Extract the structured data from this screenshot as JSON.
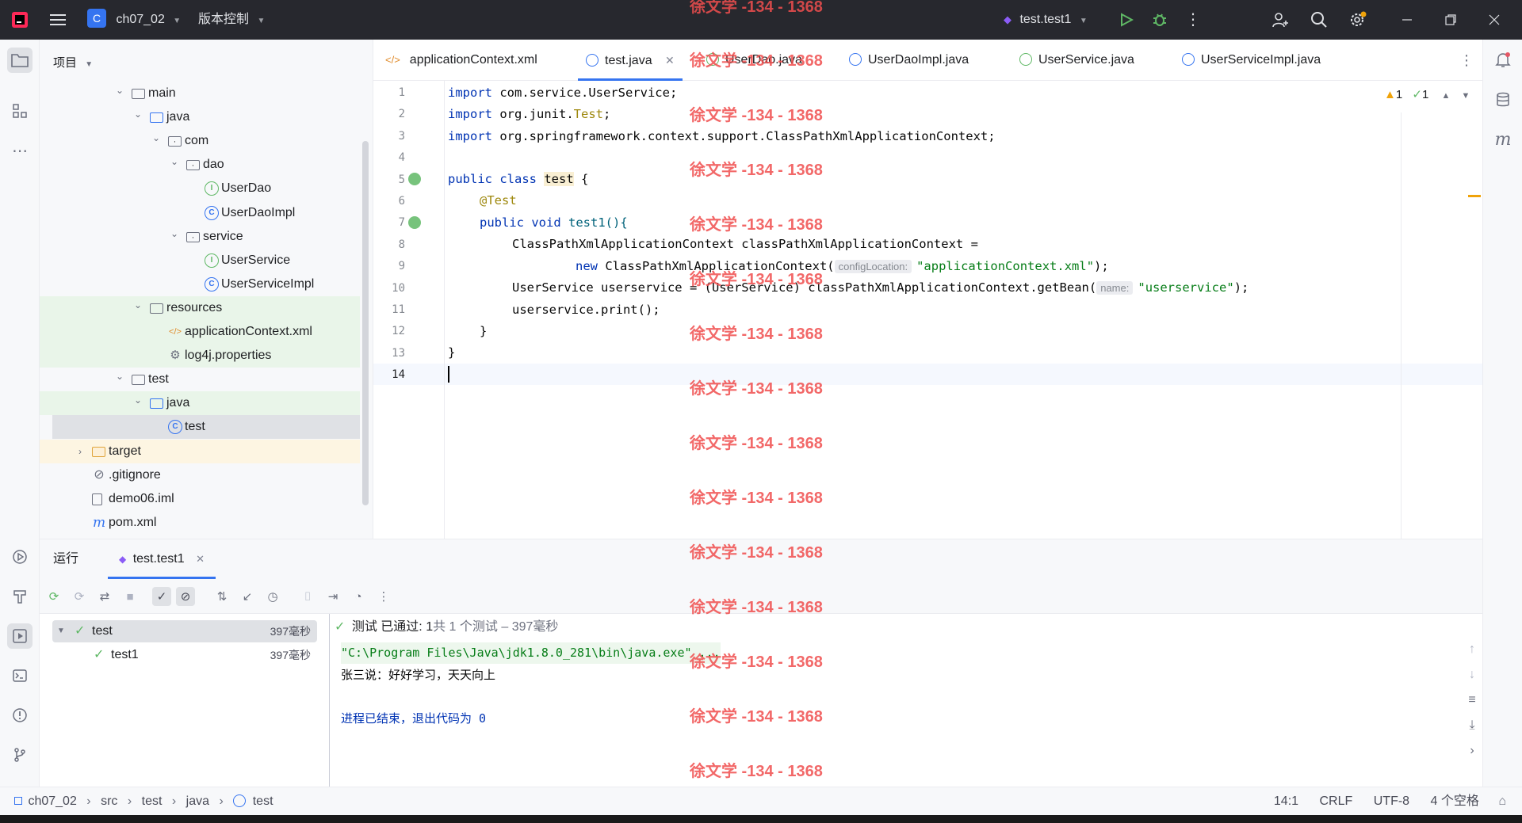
{
  "titlebar": {
    "app_icon": "intellij-icon",
    "menu_icon": "hamburger-icon",
    "project_badge": "C",
    "project_name": "ch07_02",
    "vcs_label": "版本控制",
    "run_config": "test.test1"
  },
  "project_panel": {
    "title": "项目",
    "tree": [
      {
        "label": "main",
        "kind": "folder",
        "indent": 0,
        "chevron": "down"
      },
      {
        "label": "java",
        "kind": "folder-blue",
        "indent": 1,
        "chevron": "down"
      },
      {
        "label": "com",
        "kind": "package",
        "indent": 2,
        "chevron": "down"
      },
      {
        "label": "dao",
        "kind": "package",
        "indent": 3,
        "chevron": "down"
      },
      {
        "label": "UserDao",
        "kind": "interface",
        "indent": 4,
        "chevron": ""
      },
      {
        "label": "UserDaoImpl",
        "kind": "class",
        "indent": 4,
        "chevron": ""
      },
      {
        "label": "service",
        "kind": "package",
        "indent": 3,
        "chevron": "down"
      },
      {
        "label": "UserService",
        "kind": "interface",
        "indent": 4,
        "chevron": ""
      },
      {
        "label": "UserServiceImpl",
        "kind": "class",
        "indent": 4,
        "chevron": ""
      },
      {
        "label": "resources",
        "kind": "folder",
        "indent": 1,
        "chevron": "down"
      },
      {
        "label": "applicationContext.xml",
        "kind": "xml",
        "indent": 2,
        "chevron": ""
      },
      {
        "label": "log4j.properties",
        "kind": "props",
        "indent": 2,
        "chevron": ""
      },
      {
        "label": "test",
        "kind": "folder",
        "indent": 0,
        "chevron": "down"
      },
      {
        "label": "java",
        "kind": "folder-blue",
        "indent": 1,
        "chevron": "down"
      },
      {
        "label": "test",
        "kind": "class",
        "indent": 2,
        "chevron": ""
      },
      {
        "label": "target",
        "kind": "folder-orange",
        "indent": -1,
        "chevron": "right"
      },
      {
        "label": ".gitignore",
        "kind": "ignore",
        "indent": -1,
        "chevron": ""
      },
      {
        "label": "demo06.iml",
        "kind": "iml",
        "indent": -1,
        "chevron": ""
      },
      {
        "label": "pom.xml",
        "kind": "maven",
        "indent": -1,
        "chevron": ""
      }
    ]
  },
  "editor": {
    "tabs": [
      {
        "label": "applicationContext.xml",
        "kind": "xml"
      },
      {
        "label": "test.java",
        "kind": "class",
        "active": true
      },
      {
        "label": "UserDao.java",
        "kind": "interface"
      },
      {
        "label": "UserDaoImpl.java",
        "kind": "class"
      },
      {
        "label": "UserService.java",
        "kind": "interface"
      },
      {
        "label": "UserServiceImpl.java",
        "kind": "class"
      }
    ],
    "warnings": "1",
    "checks": "1",
    "lines": [
      "1",
      "2",
      "3",
      "4",
      "5",
      "6",
      "7",
      "8",
      "9",
      "10",
      "11",
      "12",
      "13",
      "14"
    ],
    "code": {
      "l1_kw": "import",
      "l1_rest": " com.service.UserService;",
      "l2_kw": "import",
      "l2_a": " org.junit.",
      "l2_b": "Test",
      ";": ";",
      "l3_kw": "import",
      "l3_rest": " org.springframework.context.support.ClassPathXmlApplicationContext;",
      "l5_kw1": "public",
      "l5_kw2": " class ",
      "l5_name": "test",
      "l5_rest": " {",
      "l6": "@Test",
      "l7_kw1": "public",
      "l7_kw2": " void ",
      "l7_rest": "test1(){",
      "l8": "ClassPathXmlApplicationContext classPathXmlApplicationContext =",
      "l9_kw": "new",
      "l9_a": " ClassPathXmlApplicationContext(",
      "l9_hint": "configLocation:",
      "l9_str": "\"applicationContext.xml\"",
      "l9_end": ");",
      "l10_a": "UserService userservice = (UserService) classPathXmlApplicationContext.getBean(",
      "l10_hint": "name:",
      "l10_str": "\"userservice\"",
      "l10_end": ");",
      "l11": "userservice.print();",
      "l12": "}",
      "l13": "}"
    }
  },
  "run": {
    "label": "运行",
    "tab": "test.test1",
    "status_prefix": "测试 已通过: ",
    "status_count": "1",
    "status_suffix": "共 1 个测试 – 397毫秒",
    "tests": [
      {
        "name": "test",
        "time": "397毫秒"
      },
      {
        "name": "test1",
        "time": "397毫秒"
      }
    ],
    "console": [
      "\"C:\\Program Files\\Java\\jdk1.8.0_281\\bin\\java.exe\" ...",
      "张三说：好好学习，天天向上",
      "",
      "进程已结束，退出代码为 0"
    ]
  },
  "statusbar": {
    "breadcrumb": [
      "ch07_02",
      "src",
      "test",
      "java",
      "test"
    ],
    "position": "14:1",
    "line_sep": "CRLF",
    "encoding": "UTF-8",
    "indent": "4 个空格"
  },
  "watermark": "徐文学 -134 - 1368"
}
